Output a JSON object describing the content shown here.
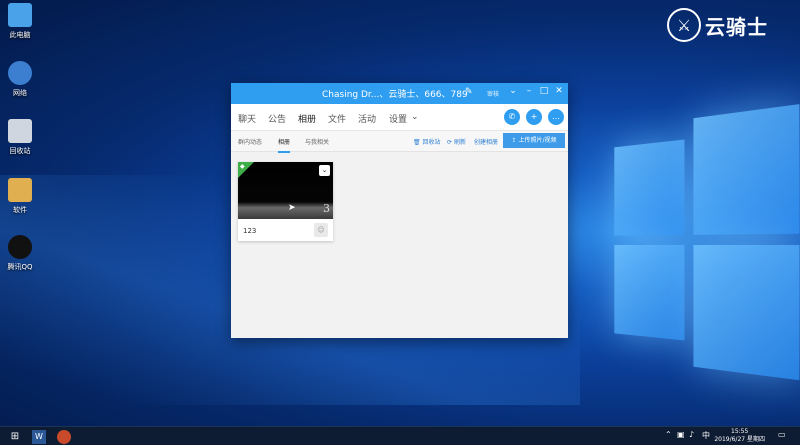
{
  "brand": {
    "text": "云骑士"
  },
  "desktop": {
    "icons": [
      {
        "label": "此电脑",
        "color": "#4aa3e8"
      },
      {
        "label": "网络",
        "color": "#3c7fd0"
      },
      {
        "label": "回收站",
        "color": "#cfd6df"
      },
      {
        "label": "软件",
        "color": "#e0b050"
      },
      {
        "label": "腾讯QQ",
        "color": "#111111"
      }
    ]
  },
  "qq": {
    "title": "Chasing Dr...、云骑士、666、789",
    "title_small": "审核",
    "tabs": [
      "聊天",
      "公告",
      "相册",
      "文件",
      "活动",
      "设置"
    ],
    "active_tab": "相册",
    "subtabs": [
      "群内动态",
      "相册",
      "与我相关"
    ],
    "actions": {
      "recycle": "回收站",
      "refresh": "刷新",
      "create": "创建相册",
      "upload": "上传照片/视频"
    },
    "album": {
      "title": "123",
      "count": "3"
    }
  },
  "taskbar": {
    "time": "15:55",
    "date": "2019/6/27 星期四",
    "ime": "中"
  },
  "colors": {
    "accent": "#2f9ef0",
    "album_corner": "#3fae49"
  }
}
